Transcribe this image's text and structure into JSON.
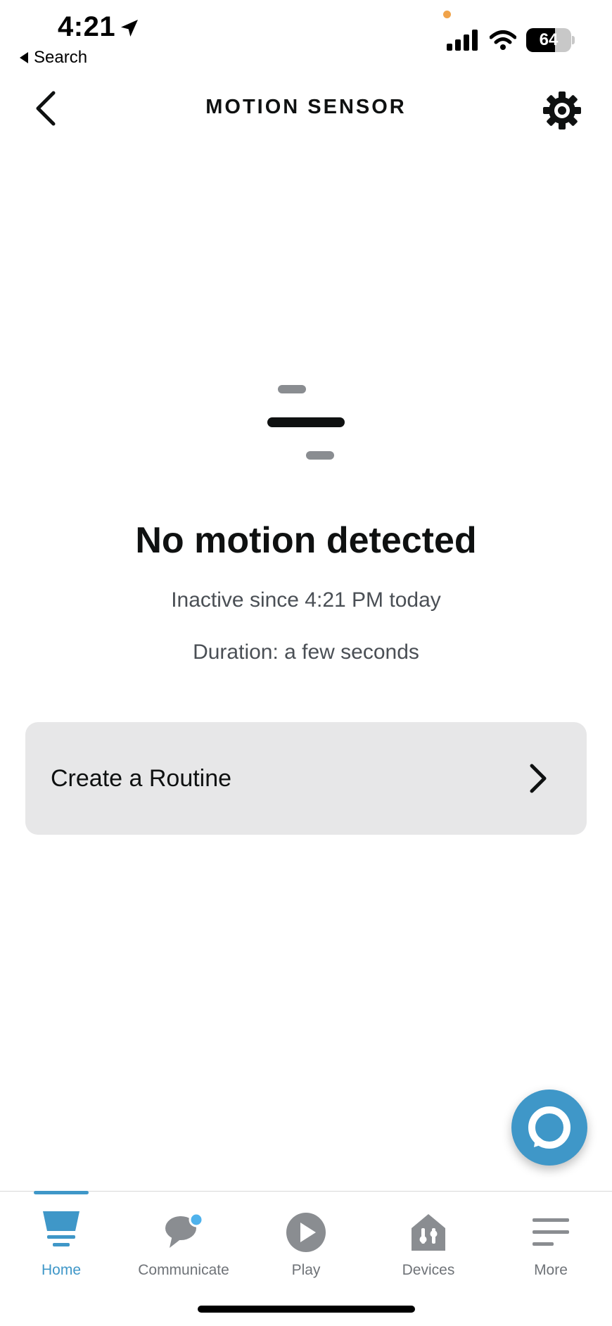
{
  "status_bar": {
    "time": "4:21",
    "back_app": "Search",
    "battery": "64"
  },
  "header": {
    "title": "MOTION SENSOR"
  },
  "sensor": {
    "status": "No motion detected",
    "inactive": "Inactive since 4:21 PM today",
    "duration": "Duration: a few seconds"
  },
  "routine": {
    "label": "Create a Routine"
  },
  "nav": {
    "items": [
      {
        "label": "Home",
        "icon": "home-icon",
        "active": true
      },
      {
        "label": "Communicate",
        "icon": "communicate-icon",
        "active": false
      },
      {
        "label": "Play",
        "icon": "play-icon",
        "active": false
      },
      {
        "label": "Devices",
        "icon": "devices-icon",
        "active": false
      },
      {
        "label": "More",
        "icon": "more-icon",
        "active": false
      }
    ]
  },
  "colors": {
    "accent": "#3f97c8",
    "card": "#e7e7e8",
    "text": "#0f1111",
    "muted": "#6f7378"
  }
}
